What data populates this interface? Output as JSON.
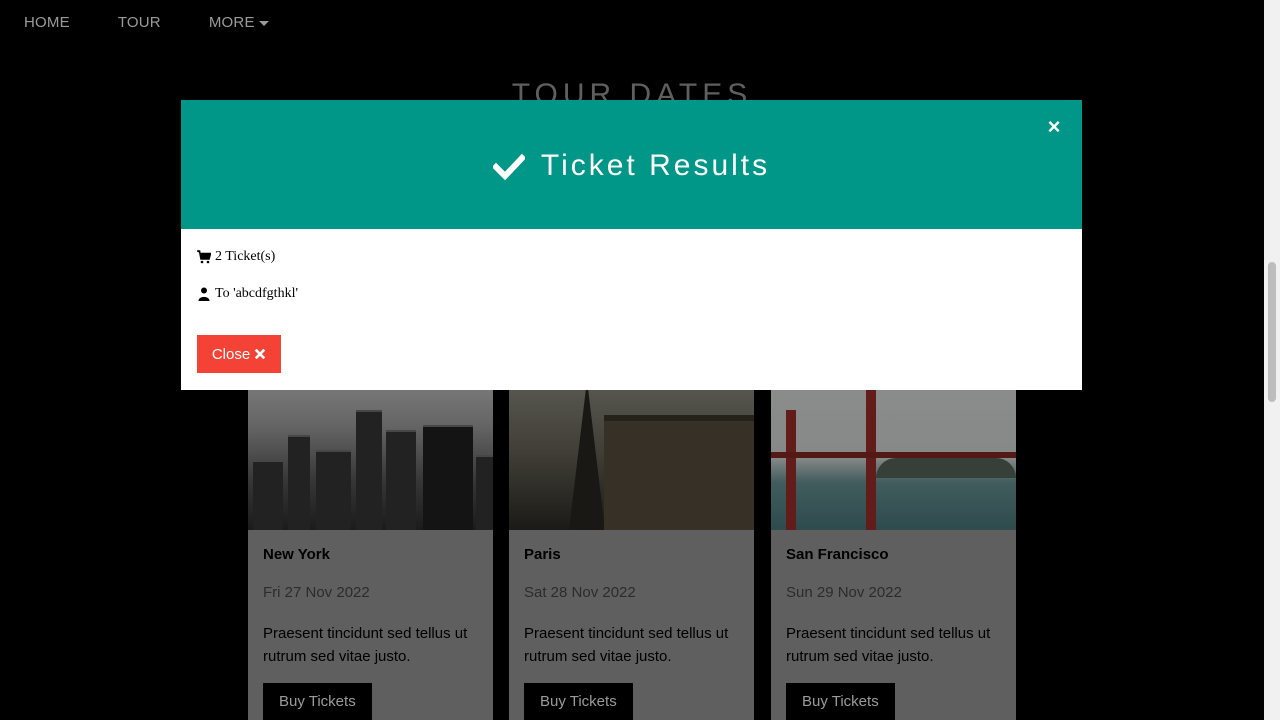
{
  "nav": {
    "items": [
      {
        "label": "HOME"
      },
      {
        "label": "TOUR"
      },
      {
        "label": "MORE"
      }
    ]
  },
  "section": {
    "title": "TOUR DATES"
  },
  "cards": [
    {
      "city": "New York",
      "date": "Fri 27 Nov 2022",
      "desc": "Praesent tincidunt sed tellus ut rutrum sed vitae justo.",
      "button": "Buy Tickets"
    },
    {
      "city": "Paris",
      "date": "Sat 28 Nov 2022",
      "desc": "Praesent tincidunt sed tellus ut rutrum sed vitae justo.",
      "button": "Buy Tickets"
    },
    {
      "city": "San Francisco",
      "date": "Sun 29 Nov 2022",
      "desc": "Praesent tincidunt sed tellus ut rutrum sed vitae justo.",
      "button": "Buy Tickets"
    }
  ],
  "modal": {
    "title": "Ticket Results",
    "close_symbol": "×",
    "tickets_text": "2 Ticket(s)",
    "recipient_text": "To 'abcdfgthkl'",
    "close_button_label": "Close"
  },
  "colors": {
    "header_accent": "#009688",
    "close_button": "#f44336",
    "card_background": "#9e9e9e"
  },
  "icons": {
    "modal_title": "check-icon",
    "tickets": "shopping-cart-icon",
    "recipient": "user-icon",
    "close_button": "times-icon"
  }
}
